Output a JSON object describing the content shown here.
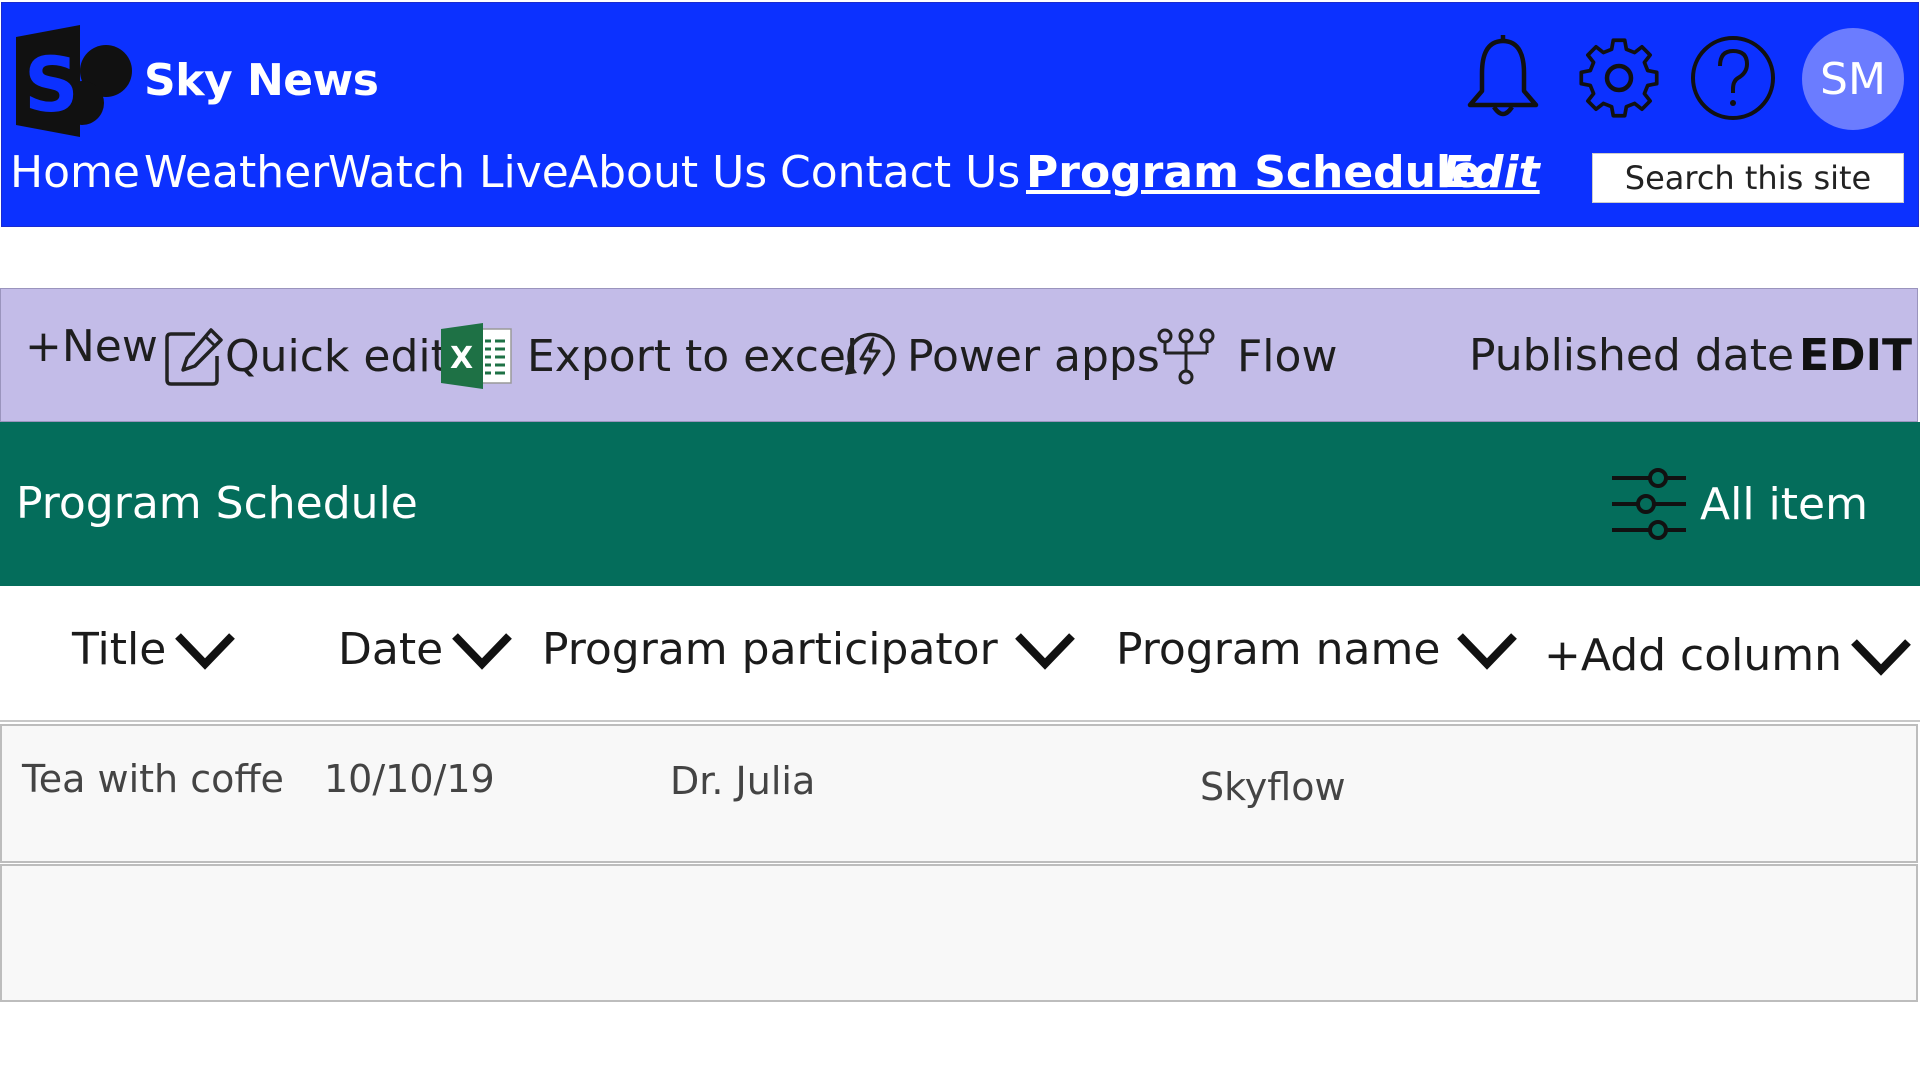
{
  "header": {
    "site_title": "Sky News",
    "logo_icon": "sharepoint-logo-icon",
    "icons": [
      "bell-icon",
      "gear-icon",
      "help-icon"
    ],
    "avatar_initials": "SM",
    "nav": [
      {
        "label": "Home"
      },
      {
        "label": "Weather"
      },
      {
        "label": "Watch Live"
      },
      {
        "label": "About Us"
      },
      {
        "label": "Contact Us"
      },
      {
        "label": "Program Schedule",
        "active": true
      },
      {
        "label": "Edit"
      }
    ],
    "search_placeholder": "Search this site",
    "colors": {
      "bar": "#0c31ff",
      "avatar": "#6b7cff"
    }
  },
  "command_bar": {
    "new_label": "+New",
    "quick_edit_label": "Quick edit",
    "export_label": "Export to excel",
    "power_apps_label": "Power apps",
    "flow_label": "Flow",
    "published_date_label": "Published date",
    "edit_label": "EDIT",
    "color": "#c3bce8"
  },
  "list": {
    "title": "Program Schedule",
    "view_label": "All item",
    "band_color": "#046d5b",
    "columns": [
      {
        "label": "Title"
      },
      {
        "label": "Date"
      },
      {
        "label": "Program participator"
      },
      {
        "label": "Program name"
      },
      {
        "label": "+Add column"
      }
    ],
    "rows": [
      {
        "title": "Tea with coffe",
        "date": "10/10/19",
        "participator": "Dr. Julia",
        "program_name": "Skyflow"
      }
    ]
  }
}
